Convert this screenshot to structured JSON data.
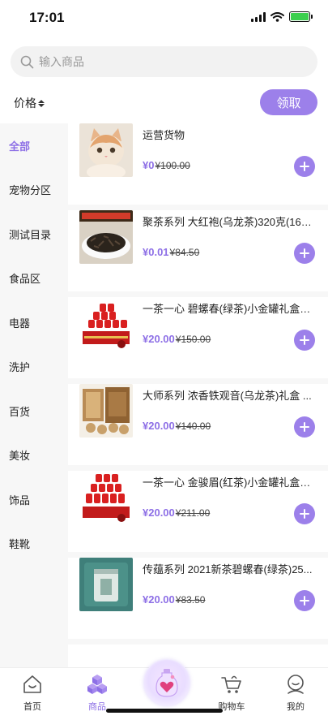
{
  "status_bar": {
    "time": "17:01"
  },
  "search": {
    "placeholder": "输入商品"
  },
  "filter": {
    "price_label": "价格",
    "claim_label": "领取"
  },
  "sidebar": {
    "items": [
      {
        "label": "全部",
        "active": true
      },
      {
        "label": "宠物分区"
      },
      {
        "label": "测试目录"
      },
      {
        "label": "食品区"
      },
      {
        "label": "电器"
      },
      {
        "label": "洗护"
      },
      {
        "label": "百货"
      },
      {
        "label": "美妆"
      },
      {
        "label": "饰品"
      },
      {
        "label": "鞋靴"
      }
    ]
  },
  "products": [
    {
      "name": "运营货物",
      "price": "¥0",
      "original_price": "¥100.00",
      "image": "cat-photo"
    },
    {
      "name": "聚茶系列 大红袍(乌龙茶)320克(160...",
      "price": "¥0.01",
      "original_price": "¥84.50",
      "image": "loose-tea-leaves"
    },
    {
      "name": "一茶一心 碧螺春(绿茶)小金罐礼盒1...",
      "price": "¥20.00",
      "original_price": "¥150.00",
      "image": "red-tea-cans"
    },
    {
      "name": "大师系列 浓香铁观音(乌龙茶)礼盒 ...",
      "price": "¥20.00",
      "original_price": "¥140.00",
      "image": "wooden-gift-box"
    },
    {
      "name": "一茶一心 金骏眉(红茶)小金罐礼盒1...",
      "price": "¥20.00",
      "original_price": "¥211.00",
      "image": "red-tea-cans"
    },
    {
      "name": "传蕴系列 2021新茶碧螺春(绿茶)25...",
      "price": "¥20.00",
      "original_price": "¥83.50",
      "image": "green-tea-canister"
    }
  ],
  "tab_bar": {
    "items": [
      {
        "label": "首页",
        "icon": "home-icon"
      },
      {
        "label": "商品",
        "icon": "cube-icon",
        "active": true
      },
      {
        "label": "",
        "icon": "heart-bottle-icon"
      },
      {
        "label": "购物车",
        "icon": "cart-icon"
      },
      {
        "label": "我的",
        "icon": "profile-icon"
      }
    ]
  },
  "colors": {
    "accent": "#9c80ea",
    "active_text": "#8d6fe6",
    "panel_bg": "#f7f7f7"
  }
}
